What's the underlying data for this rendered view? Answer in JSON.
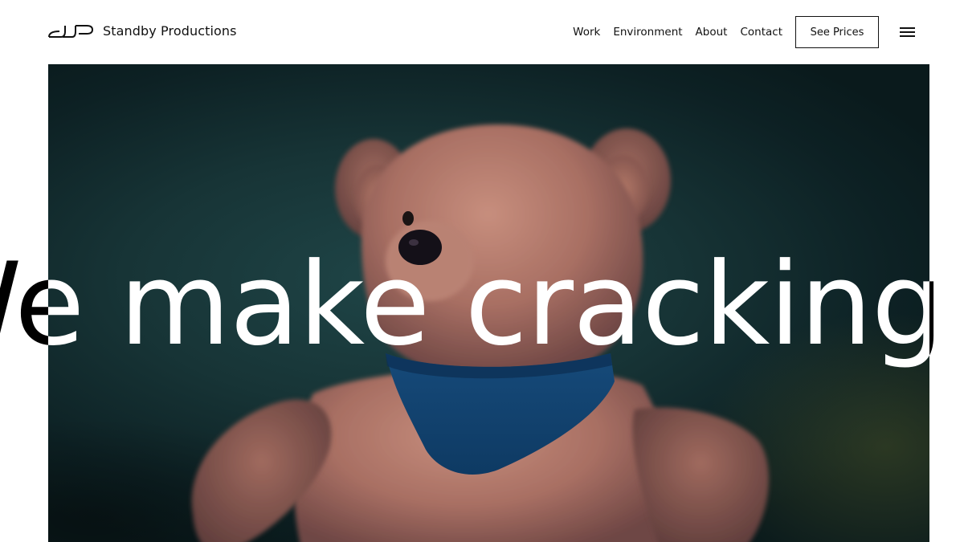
{
  "brand": {
    "name": "Standby Productions",
    "logo_icon": "standby-monogram-logo"
  },
  "nav": {
    "items": [
      {
        "label": "Work"
      },
      {
        "label": "Environment"
      },
      {
        "label": "About"
      },
      {
        "label": "Contact"
      }
    ],
    "cta_label": "See Prices",
    "menu_icon": "hamburger-menu-icon"
  },
  "hero": {
    "headline": "We make cracking films  We make cracking films",
    "image_subject": "teddy bear with blue bandana",
    "colors": {
      "background": "#0d2124",
      "headline_on_image": "#ffffff",
      "headline_on_page": "#000000"
    }
  }
}
